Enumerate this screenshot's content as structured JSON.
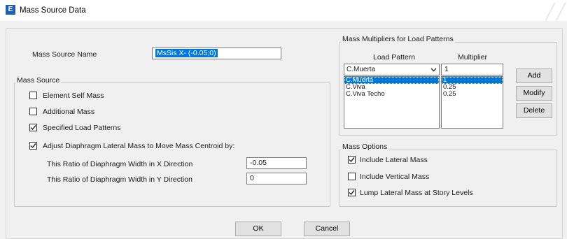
{
  "window": {
    "title": "Mass Source Data",
    "app_icon_letter": "E"
  },
  "name_row": {
    "label": "Mass Source Name",
    "value": "MsSis X- (-0.05;0)"
  },
  "mass_source": {
    "title": "Mass Source",
    "element_self_mass": {
      "label": "Element Self Mass",
      "checked": false
    },
    "additional_mass": {
      "label": "Additional Mass",
      "checked": false
    },
    "specified_load_patterns": {
      "label": "Specified Load Patterns",
      "checked": true
    },
    "adjust_diaphragm": {
      "label": "Adjust Diaphragm Lateral Mass to Move Mass Centroid by:",
      "checked": true
    },
    "ratio_x": {
      "label": "This Ratio of Diaphragm Width in X Direction",
      "value": "-0.05"
    },
    "ratio_y": {
      "label": "This Ratio of Diaphragm Width in Y Direction",
      "value": "0"
    }
  },
  "multipliers": {
    "title": "Mass Multipliers for Load Patterns",
    "col_pattern": "Load Pattern",
    "col_multiplier": "Multiplier",
    "selected_pattern": "C.Muerta",
    "multiplier_input": "1",
    "patterns": [
      "C.Muerta",
      "C.Viva",
      "C.Viva Techo"
    ],
    "values": [
      "1",
      "0.25",
      "0.25"
    ],
    "selected_index": 0,
    "add_label": "Add",
    "modify_label": "Modify",
    "delete_label": "Delete"
  },
  "mass_options": {
    "title": "Mass Options",
    "include_lateral": {
      "label": "Include Lateral Mass",
      "checked": true
    },
    "include_vertical": {
      "label": "Include Vertical Mass",
      "checked": false
    },
    "lump_lateral": {
      "label": "Lump Lateral Mass at Story Levels",
      "checked": true
    }
  },
  "footer": {
    "ok_label": "OK",
    "cancel_label": "Cancel"
  }
}
